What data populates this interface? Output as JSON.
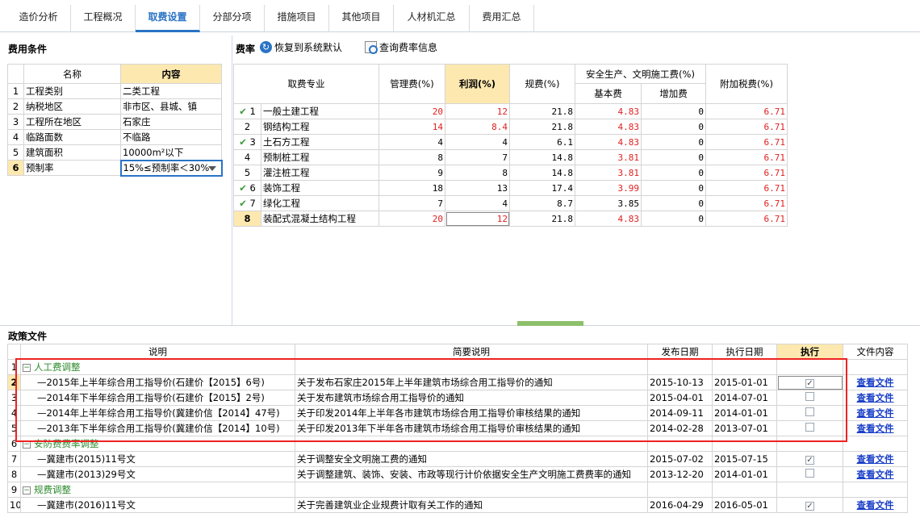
{
  "tabs": [
    "造价分析",
    "工程概况",
    "取费设置",
    "分部分项",
    "措施项目",
    "其他项目",
    "人材机汇总",
    "费用汇总"
  ],
  "active_tab": "取费设置",
  "fee_conditions": {
    "title": "费用条件",
    "col_name": "名称",
    "col_content": "内容",
    "rows": [
      {
        "no": "1",
        "name": "工程类别",
        "value": "二类工程"
      },
      {
        "no": "2",
        "name": "纳税地区",
        "value": "非市区、县城、镇"
      },
      {
        "no": "3",
        "name": "工程所在地区",
        "value": "石家庄"
      },
      {
        "no": "4",
        "name": "临路面数",
        "value": "不临路"
      },
      {
        "no": "5",
        "name": "建筑面积",
        "value": "10000m²以下"
      },
      {
        "no": "6",
        "name": "预制率",
        "value": "15%≤预制率＜30%"
      }
    ]
  },
  "rates": {
    "title": "费率",
    "restore_label": "恢复到系统默认",
    "query_label": "查询费率信息",
    "headers": {
      "specialty": "取费专业",
      "mgmt": "管理费(%)",
      "profit": "利润(%)",
      "regfee": "规费(%)",
      "safety_group": "安全生产、文明施工费(%)",
      "safety_base": "基本费",
      "safety_add": "增加费",
      "surtax": "附加税费(%)"
    },
    "rows": [
      {
        "no": "1",
        "checked": true,
        "name": "一般土建工程",
        "mgmt": "20",
        "profit": "12",
        "reg": "21.8",
        "base": "4.83",
        "add": "0",
        "tax": "6.71"
      },
      {
        "no": "2",
        "checked": false,
        "name": "钢结构工程",
        "mgmt": "14",
        "profit": "8.4",
        "reg": "21.8",
        "base": "4.83",
        "add": "0",
        "tax": "6.71"
      },
      {
        "no": "3",
        "checked": true,
        "name": "土石方工程",
        "mgmt": "4",
        "profit": "4",
        "reg": "6.1",
        "base": "4.83",
        "add": "0",
        "tax": "6.71"
      },
      {
        "no": "4",
        "checked": false,
        "name": "预制桩工程",
        "mgmt": "8",
        "profit": "7",
        "reg": "14.8",
        "base": "3.81",
        "add": "0",
        "tax": "6.71"
      },
      {
        "no": "5",
        "checked": false,
        "name": "灌注桩工程",
        "mgmt": "9",
        "profit": "8",
        "reg": "14.8",
        "base": "3.81",
        "add": "0",
        "tax": "6.71"
      },
      {
        "no": "6",
        "checked": true,
        "name": "装饰工程",
        "mgmt": "18",
        "profit": "13",
        "reg": "17.4",
        "base": "3.99",
        "add": "0",
        "tax": "6.71"
      },
      {
        "no": "7",
        "checked": true,
        "name": "绿化工程",
        "mgmt": "7",
        "profit": "4",
        "reg": "8.7",
        "base": "3.85",
        "add": "0",
        "tax": "6.71"
      },
      {
        "no": "8",
        "checked": false,
        "name": "装配式混凝土结构工程",
        "mgmt": "20",
        "profit": "12",
        "reg": "21.8",
        "base": "4.83",
        "add": "0",
        "tax": "6.71"
      }
    ]
  },
  "policy": {
    "title": "政策文件",
    "headers": {
      "desc": "说明",
      "brief": "简要说明",
      "pub": "发布日期",
      "exec_date": "执行日期",
      "exec": "执行",
      "content": "文件内容"
    },
    "link_label": "查看文件",
    "rows": [
      {
        "no": "1",
        "group": true,
        "desc": "人工费调整"
      },
      {
        "no": "2",
        "desc": "2015年上半年综合用工指导价(石建价【2015】6号)",
        "brief": "关于发布石家庄2015年上半年建筑市场综合用工指导价的通知",
        "pub": "2015-10-13",
        "exec_date": "2015-01-01",
        "checked": true
      },
      {
        "no": "3",
        "desc": "2014年下半年综合用工指导价(石建价【2015】2号)",
        "brief": "关于发布建筑市场综合用工指导价的通知",
        "pub": "2015-04-01",
        "exec_date": "2014-07-01",
        "checked": false
      },
      {
        "no": "4",
        "desc": "2014年上半年综合用工指导价(冀建价信【2014】47号)",
        "brief": "关于印发2014年上半年各市建筑市场综合用工指导价审核结果的通知",
        "pub": "2014-09-11",
        "exec_date": "2014-01-01",
        "checked": false
      },
      {
        "no": "5",
        "desc": "2013年下半年综合用工指导价(冀建价信【2014】10号)",
        "brief": "关于印发2013年下半年各市建筑市场综合用工指导价审核结果的通知",
        "pub": "2014-02-28",
        "exec_date": "2013-07-01",
        "checked": false
      },
      {
        "no": "6",
        "group": true,
        "desc": "安防费费率调整"
      },
      {
        "no": "7",
        "desc": "冀建市(2015)11号文",
        "brief": "关于调整安全文明施工费的通知",
        "pub": "2015-07-02",
        "exec_date": "2015-07-15",
        "checked": true
      },
      {
        "no": "8",
        "desc": "冀建市(2013)29号文",
        "brief": "关于调整建筑、装饰、安装、市政等现行计价依据安全生产文明施工费费率的通知",
        "pub": "2013-12-20",
        "exec_date": "2014-01-01",
        "checked": false
      },
      {
        "no": "9",
        "group": true,
        "desc": "规费调整"
      },
      {
        "no": "10",
        "desc": "冀建市(2016)11号文",
        "brief": "关于完善建筑业企业规费计取有关工作的通知",
        "pub": "2016-04-29",
        "exec_date": "2016-05-01",
        "checked": true
      }
    ]
  }
}
